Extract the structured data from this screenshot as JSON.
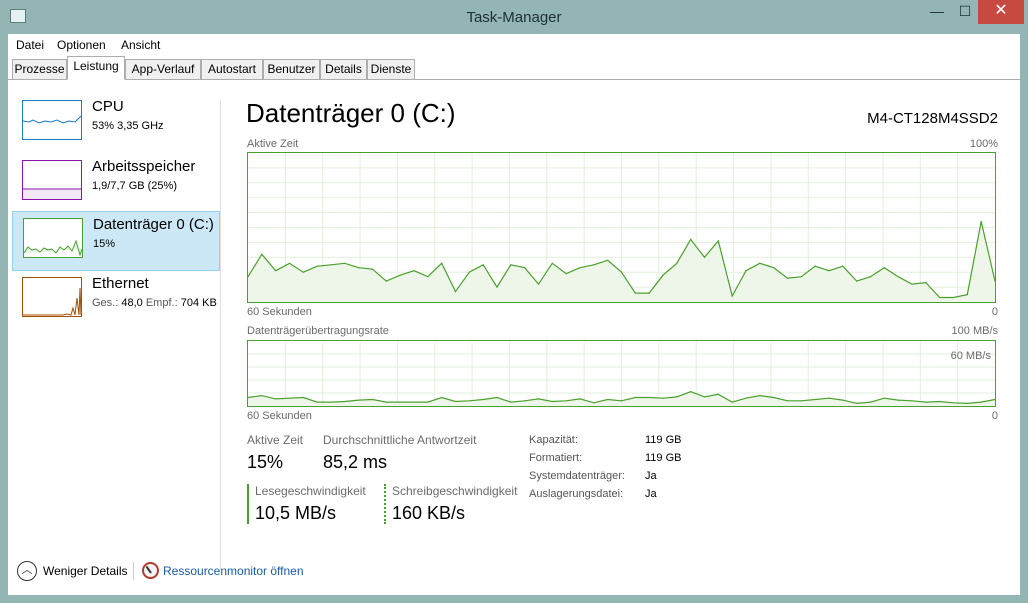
{
  "window": {
    "title": "Task-Manager",
    "controls": {
      "minimize": "—",
      "maximize": "☐",
      "close": "✕"
    }
  },
  "menu": [
    "Datei",
    "Optionen",
    "Ansicht"
  ],
  "tabs": [
    "Prozesse",
    "Leistung",
    "App-Verlauf",
    "Autostart",
    "Benutzer",
    "Details",
    "Dienste"
  ],
  "active_tab": "Leistung",
  "sidebar": {
    "items": [
      {
        "title": "CPU",
        "sub": "53%  3,35 GHz",
        "color": "#1979c3"
      },
      {
        "title": "Arbeitsspeicher",
        "sub": "1,9/7,7 GB (25%)",
        "color": "#8b12ae"
      },
      {
        "title": "Datenträger 0 (C:)",
        "sub": "15%",
        "color": "#4aa02c",
        "selected": true
      },
      {
        "title": "Ethernet",
        "sub_label1": "Ges.:",
        "sub_value1": "48,0",
        "sub_label2": "Empf.:",
        "sub_value2": "704 KB",
        "color": "#a74f01"
      }
    ]
  },
  "main": {
    "title": "Datenträger 0 (C:)",
    "model": "M4-CT128M4SSD2",
    "graph1": {
      "label": "Aktive Zeit",
      "max": "100%",
      "left": "60 Sekunden",
      "right": "0"
    },
    "graph2": {
      "label": "Datenträgerübertragungsrate",
      "max": "100 MB/s",
      "inner": "60 MB/s",
      "left": "60 Sekunden",
      "right": "0"
    },
    "stats": {
      "active_label": "Aktive Zeit",
      "active_value": "15%",
      "response_label": "Durchschnittliche Antwortzeit",
      "response_value": "85,2 ms",
      "read_label": "Lesegeschwindigkeit",
      "read_value": "10,5 MB/s",
      "write_label": "Schreibgeschwindigkeit",
      "write_value": "160 KB/s"
    },
    "properties": [
      {
        "label": "Kapazität:",
        "value": "119 GB"
      },
      {
        "label": "Formatiert:",
        "value": "119 GB"
      },
      {
        "label": "Systemdatenträger:",
        "value": "Ja"
      },
      {
        "label": "Auslagerungsdatei:",
        "value": "Ja"
      }
    ]
  },
  "footer": {
    "fewer_details": "Weniger Details",
    "resource_monitor": "Ressourcenmonitor öffnen"
  },
  "colors": {
    "disk": "#4aa02c",
    "selected_bg": "#cce8f6",
    "link": "#1a5aa6"
  },
  "chart_data": [
    {
      "type": "area",
      "title": "Aktive Zeit",
      "ylim": [
        0,
        100
      ],
      "values": [
        17,
        32,
        21,
        26,
        20,
        24,
        25,
        26,
        23,
        22,
        14,
        18,
        21,
        17,
        26,
        7,
        20,
        25,
        10,
        25,
        23,
        12,
        26,
        19,
        23,
        25,
        28,
        20,
        6,
        6,
        18,
        26,
        42,
        30,
        41,
        4,
        21,
        26,
        23,
        16,
        17,
        24,
        21,
        24,
        14,
        17,
        23,
        17,
        12,
        13,
        3,
        3,
        5,
        54,
        14
      ]
    },
    {
      "type": "area",
      "title": "Datenträgerübertragungsrate",
      "ylim": [
        0,
        100
      ],
      "values": [
        13,
        16,
        11,
        12,
        13,
        6,
        6,
        7,
        9,
        10,
        6,
        6,
        6,
        6,
        13,
        7,
        8,
        10,
        13,
        6,
        8,
        11,
        7,
        8,
        11,
        5,
        10,
        8,
        13,
        13,
        12,
        14,
        22,
        14,
        18,
        6,
        12,
        16,
        13,
        8,
        8,
        10,
        12,
        9,
        4,
        6,
        12,
        9,
        8,
        6,
        7,
        5,
        4,
        6,
        10
      ]
    }
  ]
}
